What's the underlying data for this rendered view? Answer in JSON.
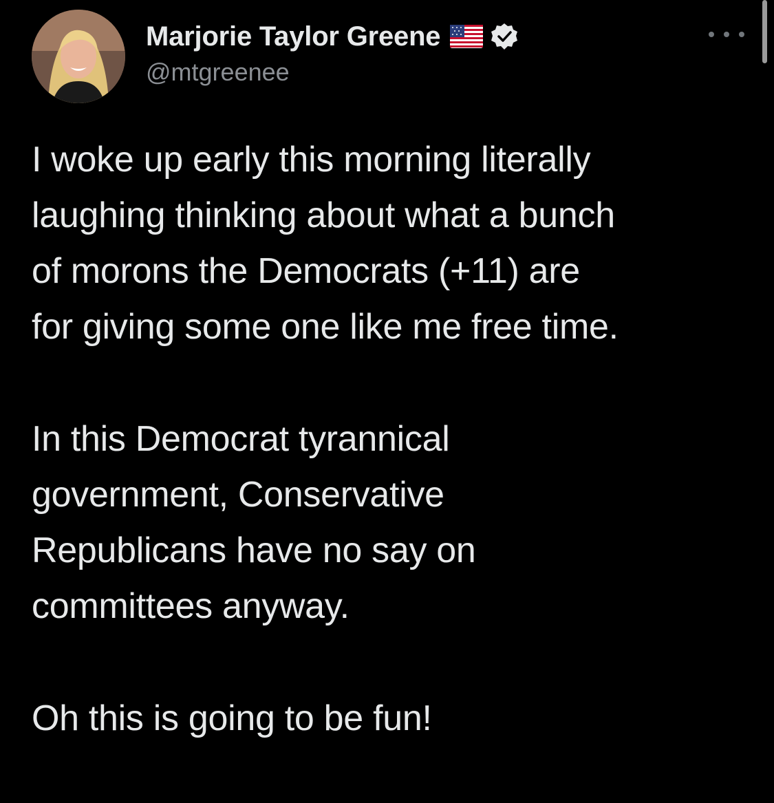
{
  "author": {
    "display_name": "Marjorie Taylor Greene",
    "handle": "@mtgreenee",
    "flag_icon": "us-flag-icon",
    "verified_icon": "verified-badge-icon",
    "avatar": "profile-photo"
  },
  "tweet": {
    "paragraphs": [
      {
        "lines": [
          "I woke up early this morning literally",
          "laughing thinking about what a bunch",
          "of morons the Democrats (+11) are",
          "for giving some one like me free time."
        ]
      },
      {
        "lines": [
          "In this Democrat tyrannical",
          "government, Conservative",
          "Republicans have no say on",
          "committees anyway."
        ]
      },
      {
        "lines": [
          "Oh this is going to be fun!"
        ]
      }
    ]
  },
  "menu": {
    "more_icon": "more-options-icon"
  },
  "colors": {
    "background": "#000000",
    "text": "#e7e9ea",
    "secondary_text": "#8b8f94"
  }
}
